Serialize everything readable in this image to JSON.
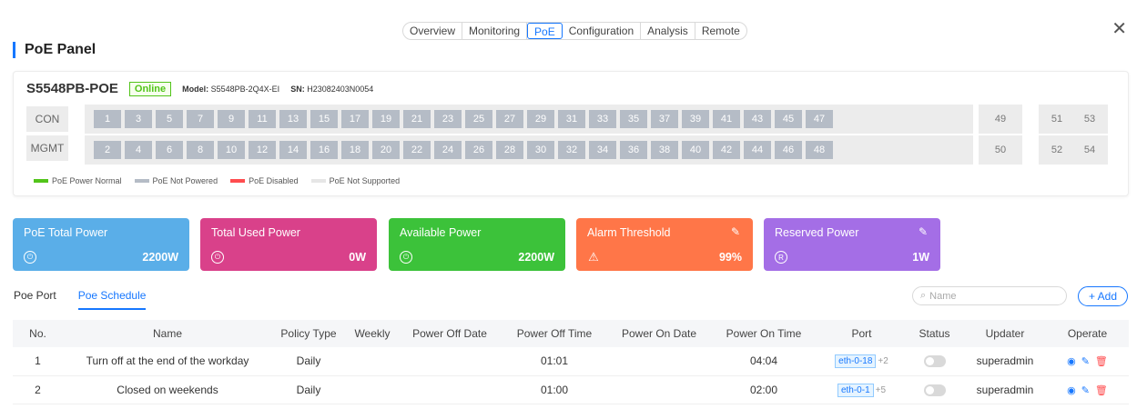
{
  "tabs": [
    "Overview",
    "Monitoring",
    "PoE",
    "Configuration",
    "Analysis",
    "Remote"
  ],
  "active_tab": "PoE",
  "panel_title": "PoE Panel",
  "device": {
    "name": "S5548PB-POE",
    "status": "Online",
    "model_label": "Model:",
    "model": "S5548PB-2Q4X-EI",
    "sn_label": "SN:",
    "sn": "H23082403N0054",
    "con_label": "CON",
    "mgmt_label": "MGMT",
    "top_ports": [
      "1",
      "3",
      "5",
      "7",
      "9",
      "11",
      "13",
      "15",
      "17",
      "19",
      "21",
      "23",
      "25",
      "27",
      "29",
      "31",
      "33",
      "35",
      "37",
      "39",
      "41",
      "43",
      "45",
      "47"
    ],
    "bottom_ports": [
      "2",
      "4",
      "6",
      "8",
      "10",
      "12",
      "14",
      "16",
      "18",
      "20",
      "22",
      "24",
      "26",
      "28",
      "30",
      "32",
      "34",
      "36",
      "38",
      "40",
      "42",
      "44",
      "46",
      "48"
    ],
    "sfp_top_single": "49",
    "sfp_bottom_single": "50",
    "sfp_top_pair": [
      "51",
      "53"
    ],
    "sfp_bottom_pair": [
      "52",
      "54"
    ]
  },
  "legend": [
    {
      "label": "PoE Power Normal",
      "color": "#52c41a"
    },
    {
      "label": "PoE Not Powered",
      "color": "#b5bcc6"
    },
    {
      "label": "PoE Disabled",
      "color": "#ff4d4f"
    },
    {
      "label": "PoE Not Supported",
      "color": "#e6e6e6"
    }
  ],
  "cards": [
    {
      "title": "PoE Total Power",
      "value": "2200W",
      "color": "#5aaee8"
    },
    {
      "title": "Total Used Power",
      "value": "0W",
      "color": "#d9418a"
    },
    {
      "title": "Available Power",
      "value": "2200W",
      "color": "#3cc23a"
    },
    {
      "title": "Alarm Threshold",
      "value": "99%",
      "color": "#ff7648"
    },
    {
      "title": "Reserved Power",
      "value": "1W",
      "color": "#a46ee6"
    }
  ],
  "sub_tabs": [
    "Poe Port",
    "Poe Schedule"
  ],
  "active_sub_tab": "Poe Schedule",
  "search_placeholder": "Name",
  "add_label": "+ Add",
  "table": {
    "columns": [
      "No.",
      "Name",
      "Policy Type",
      "Weekly",
      "Power Off Date",
      "Power Off Time",
      "Power On Date",
      "Power On Time",
      "Port",
      "Status",
      "Updater",
      "Operate"
    ],
    "rows": [
      {
        "no": "1",
        "name": "Turn off at the end of the workday",
        "policy": "Daily",
        "weekly": "",
        "off_date": "",
        "off_time": "01:01",
        "on_date": "",
        "on_time": "04:04",
        "port": "eth-0-18",
        "port_more": "+2",
        "updater": "superadmin"
      },
      {
        "no": "2",
        "name": "Closed on weekends",
        "policy": "Daily",
        "weekly": "",
        "off_date": "",
        "off_time": "01:00",
        "on_date": "",
        "on_time": "02:00",
        "port": "eth-0-1",
        "port_more": "+5",
        "updater": "superadmin"
      }
    ]
  }
}
